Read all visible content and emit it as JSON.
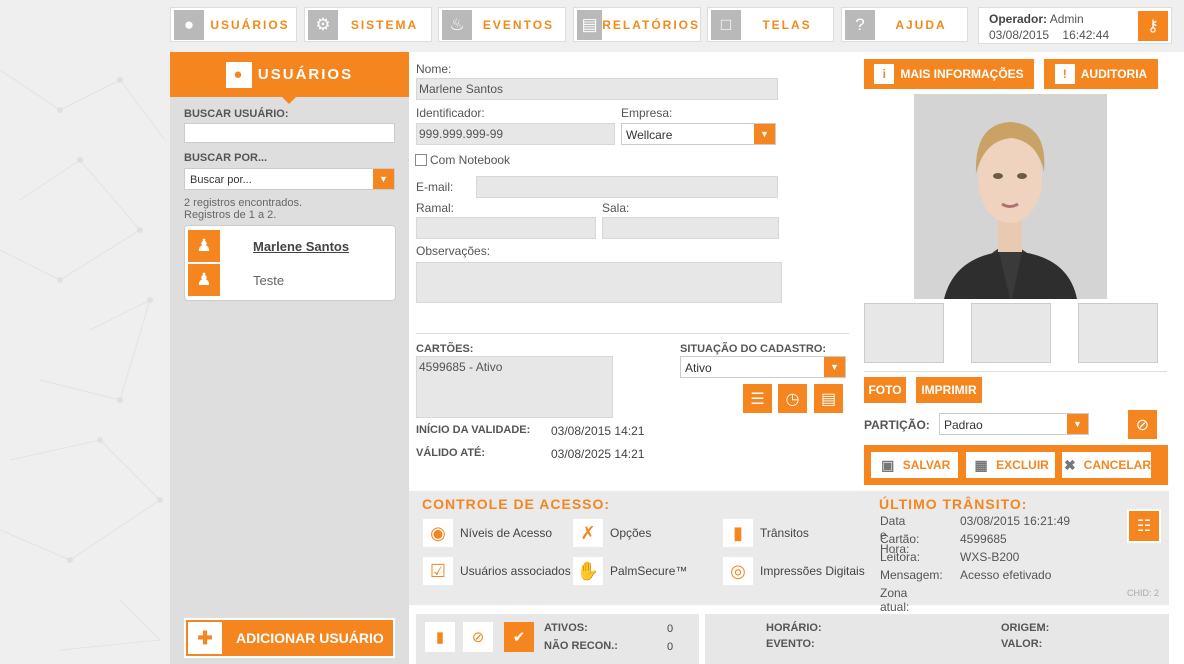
{
  "topnav": {
    "items": [
      {
        "label": "USUÁRIOS",
        "icon": "user-icon"
      },
      {
        "label": "SISTEMA",
        "icon": "gear-icon"
      },
      {
        "label": "EVENTOS",
        "icon": "bell-icon"
      },
      {
        "label": "RELATÓRIOS",
        "icon": "clipboard-icon"
      },
      {
        "label": "TELAS",
        "icon": "monitor-icon"
      },
      {
        "label": "AJUDA",
        "icon": "question-icon"
      }
    ],
    "operator_label": "Operador:",
    "operator_name": "Admin",
    "date": "03/08/2015",
    "time": "16:42:44"
  },
  "sidebar": {
    "title": "USUÁRIOS",
    "search_label": "BUSCAR USUÁRIO:",
    "search_value": "",
    "searchby_label": "BUSCAR POR...",
    "searchby_value": "Buscar por...",
    "found": "2 registros encontrados.",
    "range": "Registros de 1 a 2.",
    "users": [
      "Marlene Santos",
      "Teste"
    ],
    "add_button": "ADICIONAR USUÁRIO"
  },
  "form": {
    "name_label": "Nome:",
    "name_value": "Marlene Santos",
    "id_label": "Identificador:",
    "id_value": "999.999.999-99",
    "company_label": "Empresa:",
    "company_value": "Wellcare",
    "notebook_label": "Com Notebook",
    "email_label": "E-mail:",
    "email_value": "",
    "ramal_label": "Ramal:",
    "ramal_value": "",
    "sala_label": "Sala:",
    "sala_value": "",
    "obs_label": "Observações:",
    "obs_value": "",
    "cards_label": "CARTÕES:",
    "cards_value": "4599685 - Ativo",
    "status_label": "SITUAÇÃO DO CADASTRO:",
    "status_value": "Ativo",
    "start_label": "INÍCIO DA VALIDADE:",
    "start_value": "03/08/2015 14:21",
    "end_label": "VÁLIDO ATÉ:",
    "end_value": "03/08/2025 14:21"
  },
  "right": {
    "more_info": "MAIS INFORMAÇÕES",
    "audit": "AUDITORIA",
    "photo_button": "FOTO",
    "print_button": "IMPRIMIR",
    "partition_label": "PARTIÇÃO:",
    "partition_value": "Padrao",
    "save": "SALVAR",
    "delete": "EXCLUIR",
    "cancel": "CANCELAR"
  },
  "access": {
    "title": "CONTROLE DE ACESSO:",
    "items": [
      "Níveis de Acesso",
      "Opções",
      "Trânsitos",
      "Usuários associados",
      "PalmSecure™",
      "Impressões Digitais"
    ]
  },
  "last_transit": {
    "title": "ÚLTIMO TRÂNSITO:",
    "rows": [
      {
        "k": "Data e Hora:",
        "v": "03/08/2015 16:21:49"
      },
      {
        "k": "Cartão:",
        "v": "4599685"
      },
      {
        "k": "Leitora:",
        "v": "WXS-B200"
      },
      {
        "k": "Mensagem:",
        "v": "Acesso efetivado"
      },
      {
        "k": "Zona atual:",
        "v": ""
      }
    ],
    "chid": "CHID: 2"
  },
  "footer": {
    "active_label": "ATIVOS:",
    "active_value": "0",
    "unrec_label": "NÃO RECON.:",
    "unrec_value": "0",
    "time_label": "HORÁRIO:",
    "event_label": "EVENTO:",
    "origin_label": "ORIGEM:",
    "value_label": "VALOR:"
  },
  "colors": {
    "accent": "#f5861f",
    "panel": "#dedede"
  }
}
